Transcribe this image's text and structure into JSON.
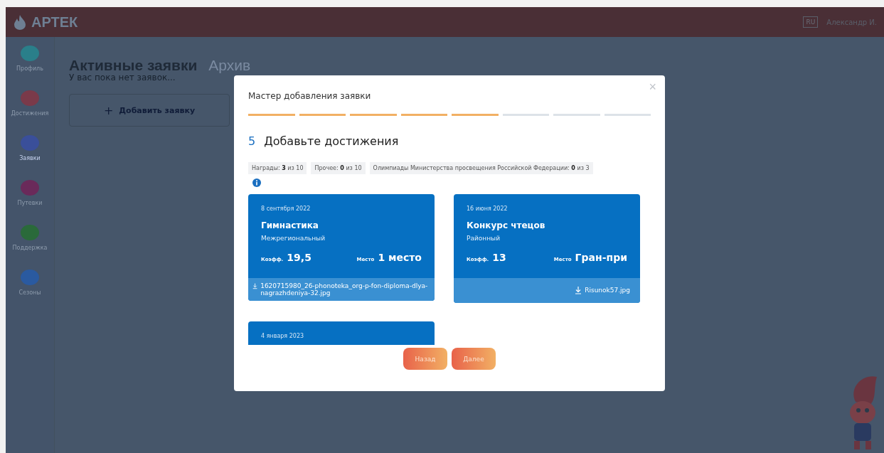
{
  "header": {
    "logo": "АРТЕК",
    "language": "RU",
    "user": "Александр И."
  },
  "sidebar": {
    "items": [
      {
        "label": "Профиль",
        "color": "#2a7f8a",
        "selected": false
      },
      {
        "label": "Достижения",
        "color": "#7a3a4a",
        "selected": false
      },
      {
        "label": "Заявки",
        "color": "#3a4f9a",
        "selected": true
      },
      {
        "label": "Путевки",
        "color": "#6a2a5a",
        "selected": false
      },
      {
        "label": "Поддержка",
        "color": "#2a6a3a",
        "selected": false
      },
      {
        "label": "Сезоны",
        "color": "#2a5aa0",
        "selected": false
      }
    ]
  },
  "tabs": [
    {
      "label": "Активные заявки",
      "selected": true
    },
    {
      "label": "Архив",
      "selected": false
    }
  ],
  "empty_message": "У вас пока нет заявок...",
  "add_button": {
    "icon": "+",
    "label": "Добавить заявку"
  },
  "modal": {
    "title": "Мастер добавления заявки",
    "close": "×",
    "steps": [
      {
        "done": true
      },
      {
        "done": true
      },
      {
        "done": true
      },
      {
        "done": true
      },
      {
        "done": true
      },
      {
        "done": false
      },
      {
        "done": false
      },
      {
        "done": false
      }
    ],
    "step_number": "5",
    "step_title": "Добавьте достижения",
    "counters": [
      {
        "label": "Награды:",
        "count": "3",
        "total": "из 10"
      },
      {
        "label": "Прочее:",
        "count": "0",
        "total": "из 10"
      },
      {
        "label": "Олимпиады Министерства просвещения Российской Федерации:",
        "count": "0",
        "total": "из 3"
      }
    ],
    "cards": [
      {
        "date": "8 сентября 2022",
        "title": "Гимнастика",
        "level": "Межрегиональный",
        "coef_label": "Коэфф.",
        "coef": "19,5",
        "place_label": "Место",
        "place": "1 место",
        "file": "1620715980_26-phonoteka_org-p-fon-diploma-dlya-nagrazhdeniya-32.jpg"
      },
      {
        "date": "16 июня 2022",
        "title": "Конкурс чтецов",
        "level": "Районный",
        "coef_label": "Коэфф.",
        "coef": "13",
        "place_label": "Место",
        "place": "Гран-при",
        "file": "Risunok57.jpg"
      },
      {
        "date": "4 января 2023"
      }
    ],
    "buttons": [
      "Назад",
      "Далее"
    ]
  }
}
